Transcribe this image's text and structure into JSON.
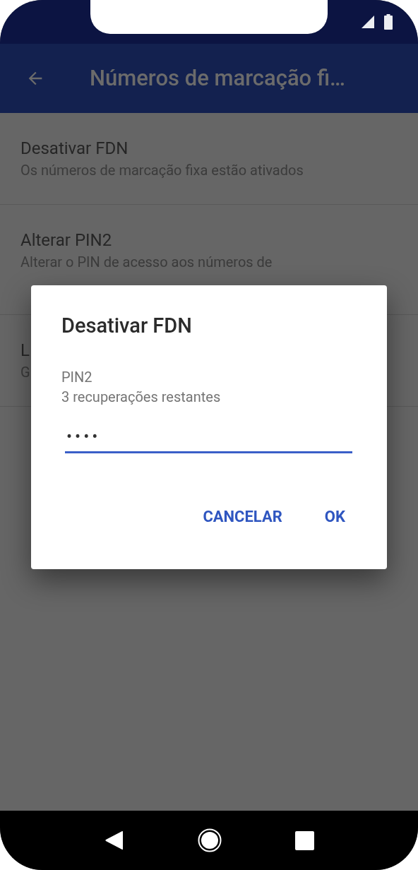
{
  "app_bar": {
    "title": "Números de marcação fi…"
  },
  "settings": [
    {
      "title": "Desativar FDN",
      "summary": "Os números de marcação fixa estão ativados"
    },
    {
      "title": "Alterar PIN2",
      "summary": "Alterar o PIN de acesso aos números de"
    },
    {
      "title": "L",
      "summary": "G"
    }
  ],
  "dialog": {
    "title": "Desativar FDN",
    "label": "PIN2",
    "hint": "3 recuperações restantes",
    "value": "••••",
    "buttons": [
      "CANCELAR",
      "OK"
    ]
  }
}
